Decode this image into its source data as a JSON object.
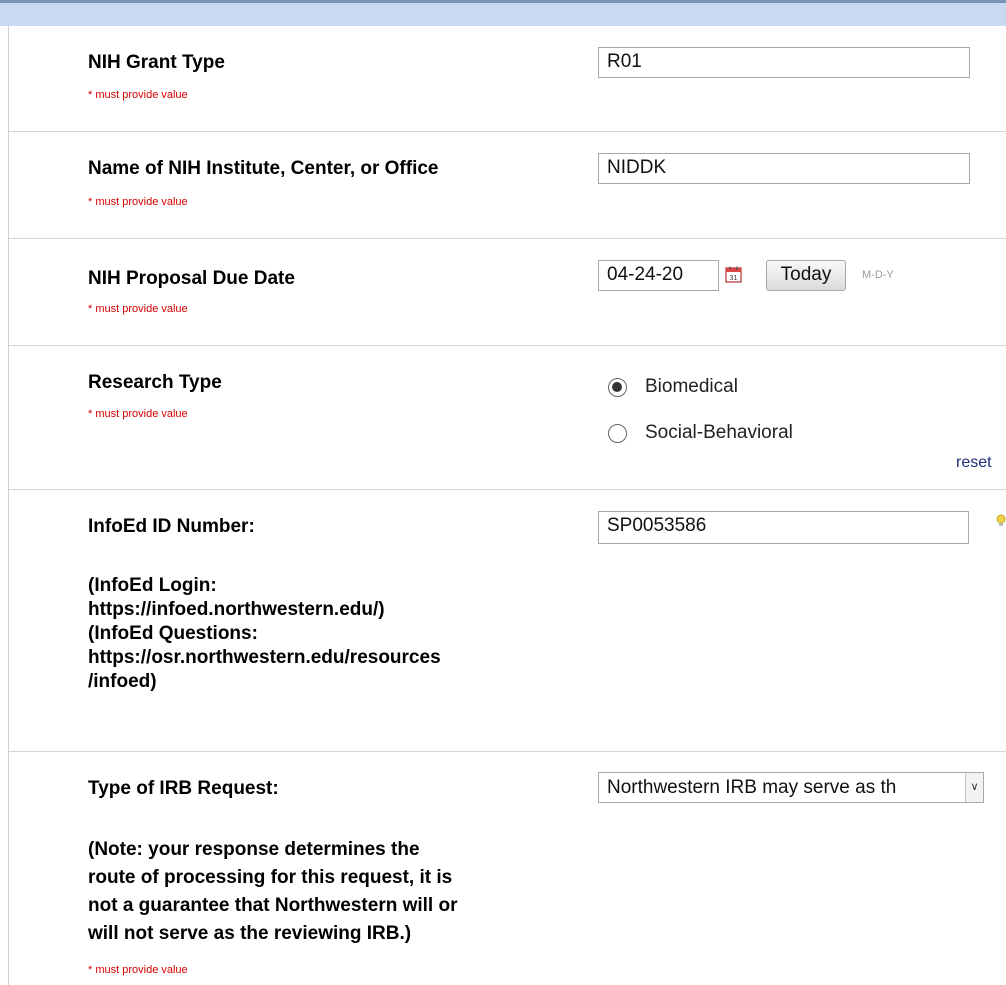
{
  "fields": {
    "grant_type": {
      "label": "NIH Grant Type",
      "required": "* must provide value",
      "value": "R01"
    },
    "institute": {
      "label": "Name of NIH Institute, Center, or Office",
      "required": "* must provide value",
      "value": "NIDDK"
    },
    "due_date": {
      "label": "NIH Proposal Due Date",
      "required": "* must provide value",
      "value": "04-24-20",
      "today_label": "Today",
      "format_hint": "M-D-Y"
    },
    "research_type": {
      "label": "Research Type",
      "required": "* must provide value",
      "options": [
        "Biomedical",
        "Social-Behavioral"
      ],
      "selected": "Biomedical",
      "reset_label": "reset"
    },
    "infoed": {
      "label": "InfoEd ID Number:",
      "note_lines": [
        "(InfoEd Login:",
        "https://infoed.northwestern.edu/)",
        "(InfoEd Questions:",
        "https://osr.northwestern.edu/resources",
        "/infoed)"
      ],
      "value": "SP0053586"
    },
    "irb": {
      "label": "Type of IRB Request:",
      "note_lines": [
        "(Note: your response determines the",
        "route of processing for this request, it is",
        "not a guarantee that Northwestern will or",
        "will not serve as the reviewing IRB.)"
      ],
      "required": "* must provide value",
      "selected_value": "Northwestern IRB may serve as th"
    }
  },
  "colors": {
    "required": "#d40000",
    "header": "#c8daf1",
    "link": "#1f2f7a"
  },
  "icons": [
    "calendar-icon",
    "chevron-down-icon",
    "radio-selected-icon",
    "radio-empty-icon"
  ]
}
